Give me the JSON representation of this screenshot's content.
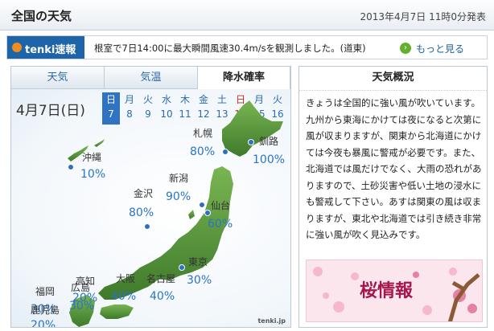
{
  "header": {
    "title": "全国の天気",
    "date": "2013年4月7日 11時0分発表"
  },
  "news": {
    "badge": "tenki速報",
    "text": "根室で7日14:00に最大瞬間風速30.4m/sを観測しました。(道東)",
    "more": "もっと見る",
    "more_icon": "arrow-right-icon"
  },
  "tabs": [
    {
      "label": "天気",
      "active": false
    },
    {
      "label": "気温",
      "active": false
    },
    {
      "label": "降水確率",
      "active": true
    }
  ],
  "map": {
    "date": "4月7日(日)",
    "days": [
      {
        "weekday": "日",
        "day": "7",
        "selected": true
      },
      {
        "weekday": "月",
        "day": "8"
      },
      {
        "weekday": "火",
        "day": "9"
      },
      {
        "weekday": "水",
        "day": "10"
      },
      {
        "weekday": "木",
        "day": "11"
      },
      {
        "weekday": "金",
        "day": "12"
      },
      {
        "weekday": "土",
        "day": "13"
      },
      {
        "weekday": "日",
        "day": "14"
      },
      {
        "weekday": "月",
        "day": "15"
      },
      {
        "weekday": "火",
        "day": "16"
      }
    ],
    "cities": [
      {
        "name": "沖縄",
        "pct": "10%"
      },
      {
        "name": "札幌",
        "pct": "80%"
      },
      {
        "name": "釧路",
        "pct": "100%"
      },
      {
        "name": "新潟",
        "pct": "90%"
      },
      {
        "name": "金沢",
        "pct": "80%"
      },
      {
        "name": "仙台",
        "pct": "60%"
      },
      {
        "name": "福岡",
        "pct": "30%"
      },
      {
        "name": "広島",
        "pct": "30%"
      },
      {
        "name": "東京",
        "pct": "30%"
      },
      {
        "name": "高知",
        "pct": "20%"
      },
      {
        "name": "大阪",
        "pct": "40%"
      },
      {
        "name": "名古屋",
        "pct": "40%"
      },
      {
        "name": "鹿児島",
        "pct": "20%"
      }
    ],
    "logo": "tenki.jp"
  },
  "overview": {
    "title": "天気概況",
    "text": "きょうは全国的に強い風が吹いています。九州から東海にかけては夜になると次第に風が収まりますが、関東から北海道にかけては今夜も暴風に警戒が必要です。また、北海道では風だけでなく、大雨の恐れがありますので、土砂災害や低い土地の浸水にも警戒して下さい。あすは関東の風は収まりますが、東北や北海道では引き続き非常に強い風が吹く見込みです。",
    "banner": "桜情報"
  },
  "colors": {
    "accent": "#1e64a8",
    "percent": "#2a73c6",
    "land": "#5d9a3c",
    "sunday": "#d8281e"
  }
}
